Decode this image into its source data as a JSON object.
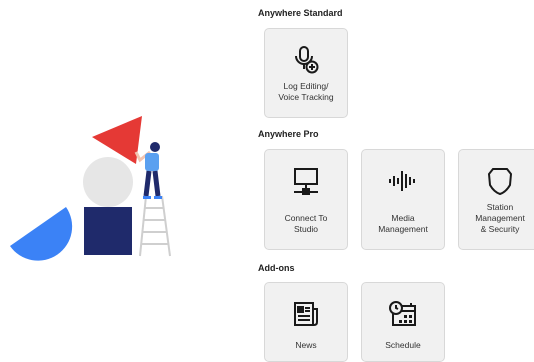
{
  "sections": {
    "standard": {
      "title": "Anywhere Standard"
    },
    "pro": {
      "title": "Anywhere Pro"
    },
    "addons": {
      "title": "Add-ons"
    }
  },
  "tiles": {
    "log_editing": {
      "label": "Log Editing/\nVoice Tracking",
      "icon": "microphone-plus-icon"
    },
    "connect_studio": {
      "label": "Connect To\nStudio",
      "icon": "monitor-network-icon"
    },
    "media_management": {
      "label": "Media\nManagement",
      "icon": "audio-waveform-icon"
    },
    "station_security": {
      "label": "Station\nManagement\n& Security",
      "icon": "shield-badge-icon"
    },
    "news": {
      "label": "News",
      "icon": "newspaper-icon"
    },
    "schedule": {
      "label": "Schedule",
      "icon": "calendar-clock-icon"
    }
  },
  "colors": {
    "triangle": "#e53935",
    "half_circle": "#3b82f6",
    "square": "#1f2a6b",
    "circle": "#e6e6e6",
    "tile_bg": "#f1f1f1"
  }
}
